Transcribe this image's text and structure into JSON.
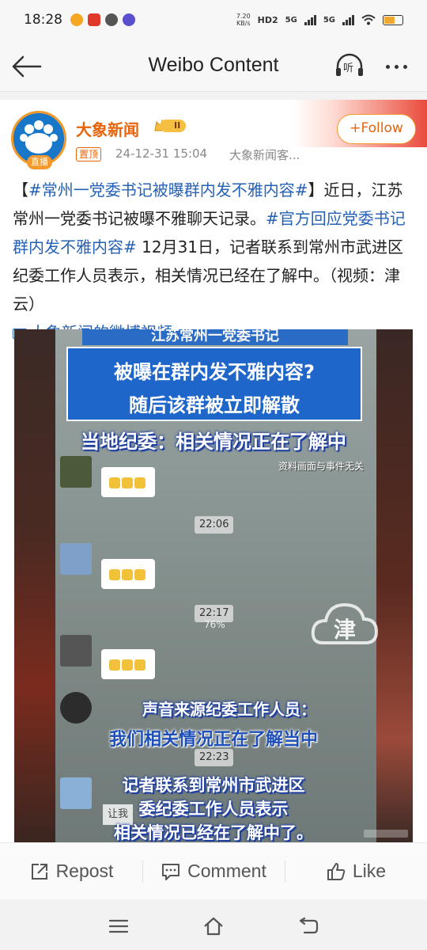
{
  "status_bar": {
    "time": "18:28",
    "net_speed_value": "7.20",
    "net_speed_unit": "KB/s",
    "hd_label": "HD2",
    "network_1": "5G",
    "network_2": "5G"
  },
  "header": {
    "title": "Weibo Content",
    "listen_label": "听"
  },
  "post": {
    "author": "大象新闻",
    "vip_level": "II",
    "live_label": "直播",
    "pin_label": "置顶",
    "timestamp": "24-12-31 15:04",
    "source": "大象新闻客...",
    "follow_label": "+Follow",
    "text": {
      "bracket_open": "【",
      "tag1": "#常州一党委书记被曝群内发不雅内容#",
      "part1": "】近日，江苏常州一党委书记被曝不雅聊天记录。",
      "tag2": "#官方回应党委书记群内发不雅内容#",
      "part2": " 12月31日，记者联系到常州市武进区纪委工作人员表示，相关情况已经在了解中。（视频：津云）"
    },
    "video_link": "大象新闻的微博视频"
  },
  "video": {
    "top_partial": "江苏常州一党委书记",
    "banner_line1": "被曝在群内发不雅内容?",
    "banner_line2": "随后该群被立即解散",
    "headline": "当地纪委：相关情况正在了解中",
    "disclaimer": "资料画面与事件无关",
    "time_chips": [
      "22:06",
      "22:17",
      "22:23"
    ],
    "zoom": "76%",
    "watermark": "津",
    "caption_1": "声音来源纪委工作人员：",
    "caption_2": "我们相关情况正在了解当中",
    "caption_3": "记者联系到常州市武进区",
    "caption_4": "委纪委工作人员表示",
    "caption_5": "相关情况已经在了解中了。",
    "partial_chat": "让我"
  },
  "actions": {
    "repost": "Repost",
    "comment": "Comment",
    "like": "Like"
  },
  "colors": {
    "accent_orange": "#e8630a",
    "link_blue": "#2561b5",
    "video_blue": "#1e66c9"
  }
}
